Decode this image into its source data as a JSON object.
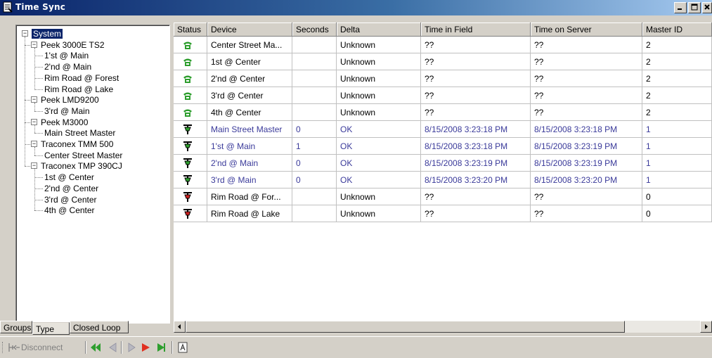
{
  "window": {
    "title": "Time Sync",
    "icon": "document-icon"
  },
  "tree": {
    "root": "System",
    "groups": [
      {
        "label": "Peek 3000E TS2",
        "children": [
          "1'st @ Main",
          "2'nd @ Main",
          "Rim Road @ Forest",
          "Rim Road @ Lake"
        ]
      },
      {
        "label": "Peek LMD9200",
        "children": [
          "3'rd @ Main"
        ]
      },
      {
        "label": "Peek M3000",
        "children": [
          "Main Street Master"
        ]
      },
      {
        "label": "Traconex TMM 500",
        "children": [
          "Center Street Master"
        ]
      },
      {
        "label": "Traconex TMP 390CJ",
        "children": [
          "1st @ Center",
          "2'nd @ Center",
          "3'rd @ Center",
          "4th @ Center"
        ]
      }
    ]
  },
  "tabs": [
    "Groups",
    "Type",
    "Closed Loop"
  ],
  "active_tab": "Type",
  "grid": {
    "columns": [
      "Status",
      "Device",
      "Seconds",
      "Delta",
      "Time in Field",
      "Time on Server",
      "Master ID"
    ],
    "rows": [
      {
        "status": "phone-green-icon",
        "device": "Center Street Ma...",
        "seconds": "",
        "delta": "Unknown",
        "field": "??",
        "server": "??",
        "master": "2"
      },
      {
        "status": "phone-green-icon",
        "device": "1st @ Center",
        "seconds": "",
        "delta": "Unknown",
        "field": "??",
        "server": "??",
        "master": "2"
      },
      {
        "status": "phone-green-icon",
        "device": "2'nd @ Center",
        "seconds": "",
        "delta": "Unknown",
        "field": "??",
        "server": "??",
        "master": "2"
      },
      {
        "status": "phone-green-icon",
        "device": "3'rd @ Center",
        "seconds": "",
        "delta": "Unknown",
        "field": "??",
        "server": "??",
        "master": "2"
      },
      {
        "status": "phone-green-icon",
        "device": "4th @ Center",
        "seconds": "",
        "delta": "Unknown",
        "field": "??",
        "server": "??",
        "master": "2"
      },
      {
        "status": "signal-green-icon",
        "device": "Main Street Master",
        "seconds": "0",
        "delta": "OK",
        "field": "8/15/2008 3:23:18 PM",
        "server": "8/15/2008 3:23:18 PM",
        "master": "1"
      },
      {
        "status": "signal-green-icon",
        "device": "1'st @ Main",
        "seconds": "1",
        "delta": "OK",
        "field": "8/15/2008 3:23:18 PM",
        "server": "8/15/2008 3:23:19 PM",
        "master": "1"
      },
      {
        "status": "signal-green-icon",
        "device": "2'nd @ Main",
        "seconds": "0",
        "delta": "OK",
        "field": "8/15/2008 3:23:19 PM",
        "server": "8/15/2008 3:23:19 PM",
        "master": "1"
      },
      {
        "status": "signal-green-icon",
        "device": "3'rd @ Main",
        "seconds": "0",
        "delta": "OK",
        "field": "8/15/2008 3:23:20 PM",
        "server": "8/15/2008 3:23:20 PM",
        "master": "1"
      },
      {
        "status": "signal-red-icon",
        "device": "Rim Road @ For...",
        "seconds": "",
        "delta": "Unknown",
        "field": "??",
        "server": "??",
        "master": "0"
      },
      {
        "status": "signal-red-icon",
        "device": "Rim Road @ Lake",
        "seconds": "",
        "delta": "Unknown",
        "field": "??",
        "server": "??",
        "master": "0"
      }
    ]
  },
  "toolbar": {
    "disconnect": "Disconnect"
  },
  "colors": {
    "title_start": "#0a246a",
    "title_end": "#a6caf0",
    "synced_text": "#3a3a9a",
    "green": "#2e9e2e",
    "red": "#cc2020"
  }
}
